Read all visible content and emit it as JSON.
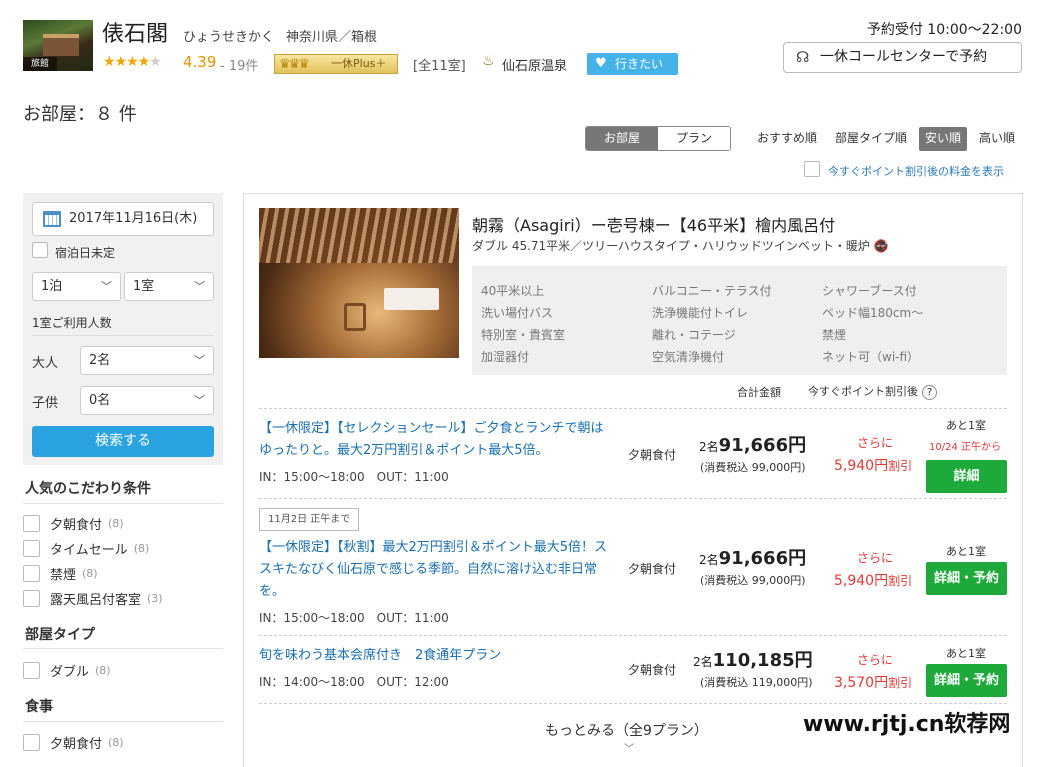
{
  "hotel": {
    "photo_tag": "旅館",
    "name": "俵石閣",
    "kana": "ひょうせきかく",
    "location": "神奈川県／箱根",
    "stars_on": "★★★★",
    "stars_off": "★",
    "rating": "4.39",
    "reviews": "- 19件",
    "plus_badge": "一休Plus＋",
    "rooms_total": "[全11室]",
    "onsen": "仙石原温泉",
    "wish_button": "行きたい"
  },
  "reservation": {
    "hours": "予約受付 10:00〜22:00",
    "call_button": "一休コールセンターで予約"
  },
  "rooms_heading": "お部屋：８ 件",
  "view_toggle": {
    "rooms": "お部屋",
    "plans": "プラン"
  },
  "sort": {
    "recommended": "おすすめ順",
    "room_type": "部屋タイプ順",
    "cheap": "安い順",
    "expensive": "高い順"
  },
  "point_discount_label": "今すぐポイント割引後の料金を表示",
  "search": {
    "date": "2017年11月16日(木)",
    "undecided": "宿泊日未定",
    "nights": "1泊",
    "rooms": "1室",
    "guests_label": "1室ご利用人数",
    "adults_label": "大人",
    "adults_value": "2名",
    "children_label": "子供",
    "children_value": "0名",
    "search_button": "検索する"
  },
  "filters": {
    "popular_title": "人気のこだわり条件",
    "popular": [
      {
        "label": "夕朝食付",
        "count": "(8)"
      },
      {
        "label": "タイムセール",
        "count": "(8)"
      },
      {
        "label": "禁煙",
        "count": "(8)"
      },
      {
        "label": "露天風呂付客室",
        "count": "(3)"
      }
    ],
    "room_type_title": "部屋タイプ",
    "room_type": [
      {
        "label": "ダブル",
        "count": "(8)"
      }
    ],
    "meal_title": "食事",
    "meal": [
      {
        "label": "夕朝食付",
        "count": "(8)"
      }
    ]
  },
  "room": {
    "title": "朝霧（Asagiri）ー壱号棟ー【46平米】檜内風呂付",
    "subtitle": "ダブル 45.71平米／ツリーハウスタイプ・ハリウッドツインベット・暖炉",
    "amenities": [
      "40平米以上",
      "バルコニー・テラス付",
      "シャワーブース付",
      "洗い場付バス",
      "洗浄機能付トイレ",
      "ベッド幅180cm〜",
      "特別室・貴賓室",
      "離れ・コテージ",
      "禁煙",
      "加湿器付",
      "空気清浄機付",
      "ネット可（wi-fi）"
    ],
    "total_label": "合計金額",
    "point_label": "今すぐポイント割引後",
    "help": "?"
  },
  "plans": [
    {
      "name": "【一休限定】【セレクションセール】ご夕食とランチで朝はゆったりと。最大2万円割引＆ポイント最大5倍。",
      "time": "IN：15:00〜18:00　OUT：11:00",
      "meal": "夕朝食付",
      "people": "2名",
      "price": "91,666円",
      "tax": "(消費税込 99,000円)",
      "sarani": "さらに",
      "discount": "5,940円",
      "discount_suffix": "割引",
      "remain": "あと1室",
      "deadline": "10/24 正午から",
      "button": "詳細"
    },
    {
      "date_tag": "11月2日 正午まで",
      "name": "【一休限定】【秋割】最大2万円割引＆ポイント最大5倍！ススキたなびく仙石原で感じる季節。自然に溶け込む非日常を。",
      "time": "IN：15:00〜18:00　OUT：11:00",
      "meal": "夕朝食付",
      "people": "2名",
      "price": "91,666円",
      "tax": "(消費税込 99,000円)",
      "sarani": "さらに",
      "discount": "5,940円",
      "discount_suffix": "割引",
      "remain": "あと1室",
      "button": "詳細・予約"
    },
    {
      "name": "旬を味わう基本会席付き　2食通年プラン",
      "time": "IN：14:00〜18:00　OUT：12:00",
      "meal": "夕朝食付",
      "people": "2名",
      "price": "110,185円",
      "tax": "(消費税込 119,000円)",
      "sarani": "さらに",
      "discount": "3,570円",
      "discount_suffix": "割引",
      "remain": "あと1室",
      "button": "詳細・予約"
    }
  ],
  "more_plans": "もっとみる（全9プラン）",
  "watermark": "www.rjtj.cn软荐网",
  "colors": {
    "accent_green": "#1eaa3a",
    "accent_blue": "#2ba3e0",
    "discount_red": "#e53935",
    "link_blue": "#1a6fb0"
  }
}
